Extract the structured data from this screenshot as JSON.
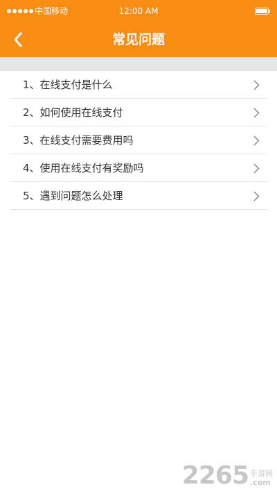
{
  "status_bar": {
    "carrier": "中国移动",
    "time": "12:00 AM",
    "signal_icon": "signal-dots-icon",
    "battery_icon": "battery-icon"
  },
  "nav": {
    "title": "常见问题",
    "back_icon": "chevron-left-icon"
  },
  "faq": {
    "items": [
      {
        "label": "1、在线支付是什么"
      },
      {
        "label": "2、如何使用在线支付"
      },
      {
        "label": "3、在线支付需要费用吗"
      },
      {
        "label": "4、使用在线支付有奖励吗"
      },
      {
        "label": "5、遇到问题怎么处理"
      }
    ],
    "item_icon": "chevron-right-icon"
  },
  "watermark": {
    "number": "2265",
    "site": "手游网",
    "domain": ".com"
  },
  "colors": {
    "accent": "#f98d14",
    "separator_band": "#e6e6e6",
    "text": "#333333",
    "chevron": "#8a8a8a"
  }
}
